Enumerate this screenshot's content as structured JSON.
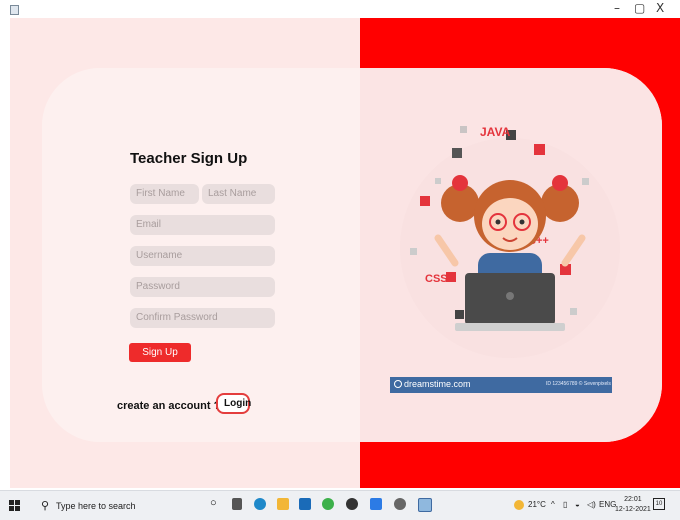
{
  "window": {
    "minimize": "–",
    "maximize": "▢",
    "close": "X"
  },
  "form": {
    "title": "Teacher Sign Up",
    "first_name_placeholder": "First Name",
    "last_name_placeholder": "Last Name",
    "email_placeholder": "Email",
    "username_placeholder": "Username",
    "password_placeholder": "Password",
    "confirm_password_placeholder": "Confirm Password",
    "signup_label": "Sign Up",
    "create_account_text": "create an account ?",
    "login_label": "Login"
  },
  "illustration": {
    "tags": [
      "JAVA",
      "C++",
      "CSS"
    ],
    "watermark_text": "dreamstime.com",
    "watermark_id": "ID 123456789 © Sevenpixels"
  },
  "colors": {
    "accent": "#ee2b2b",
    "right_panel": "#ff0000",
    "left_panel": "#fde8e7",
    "card": "#fdf0ef"
  },
  "taskbar": {
    "search_placeholder": "Type here to search",
    "temperature": "21°C",
    "language": "ENG",
    "time": "22:01",
    "date": "12-12-2021",
    "notification_count": "10"
  }
}
